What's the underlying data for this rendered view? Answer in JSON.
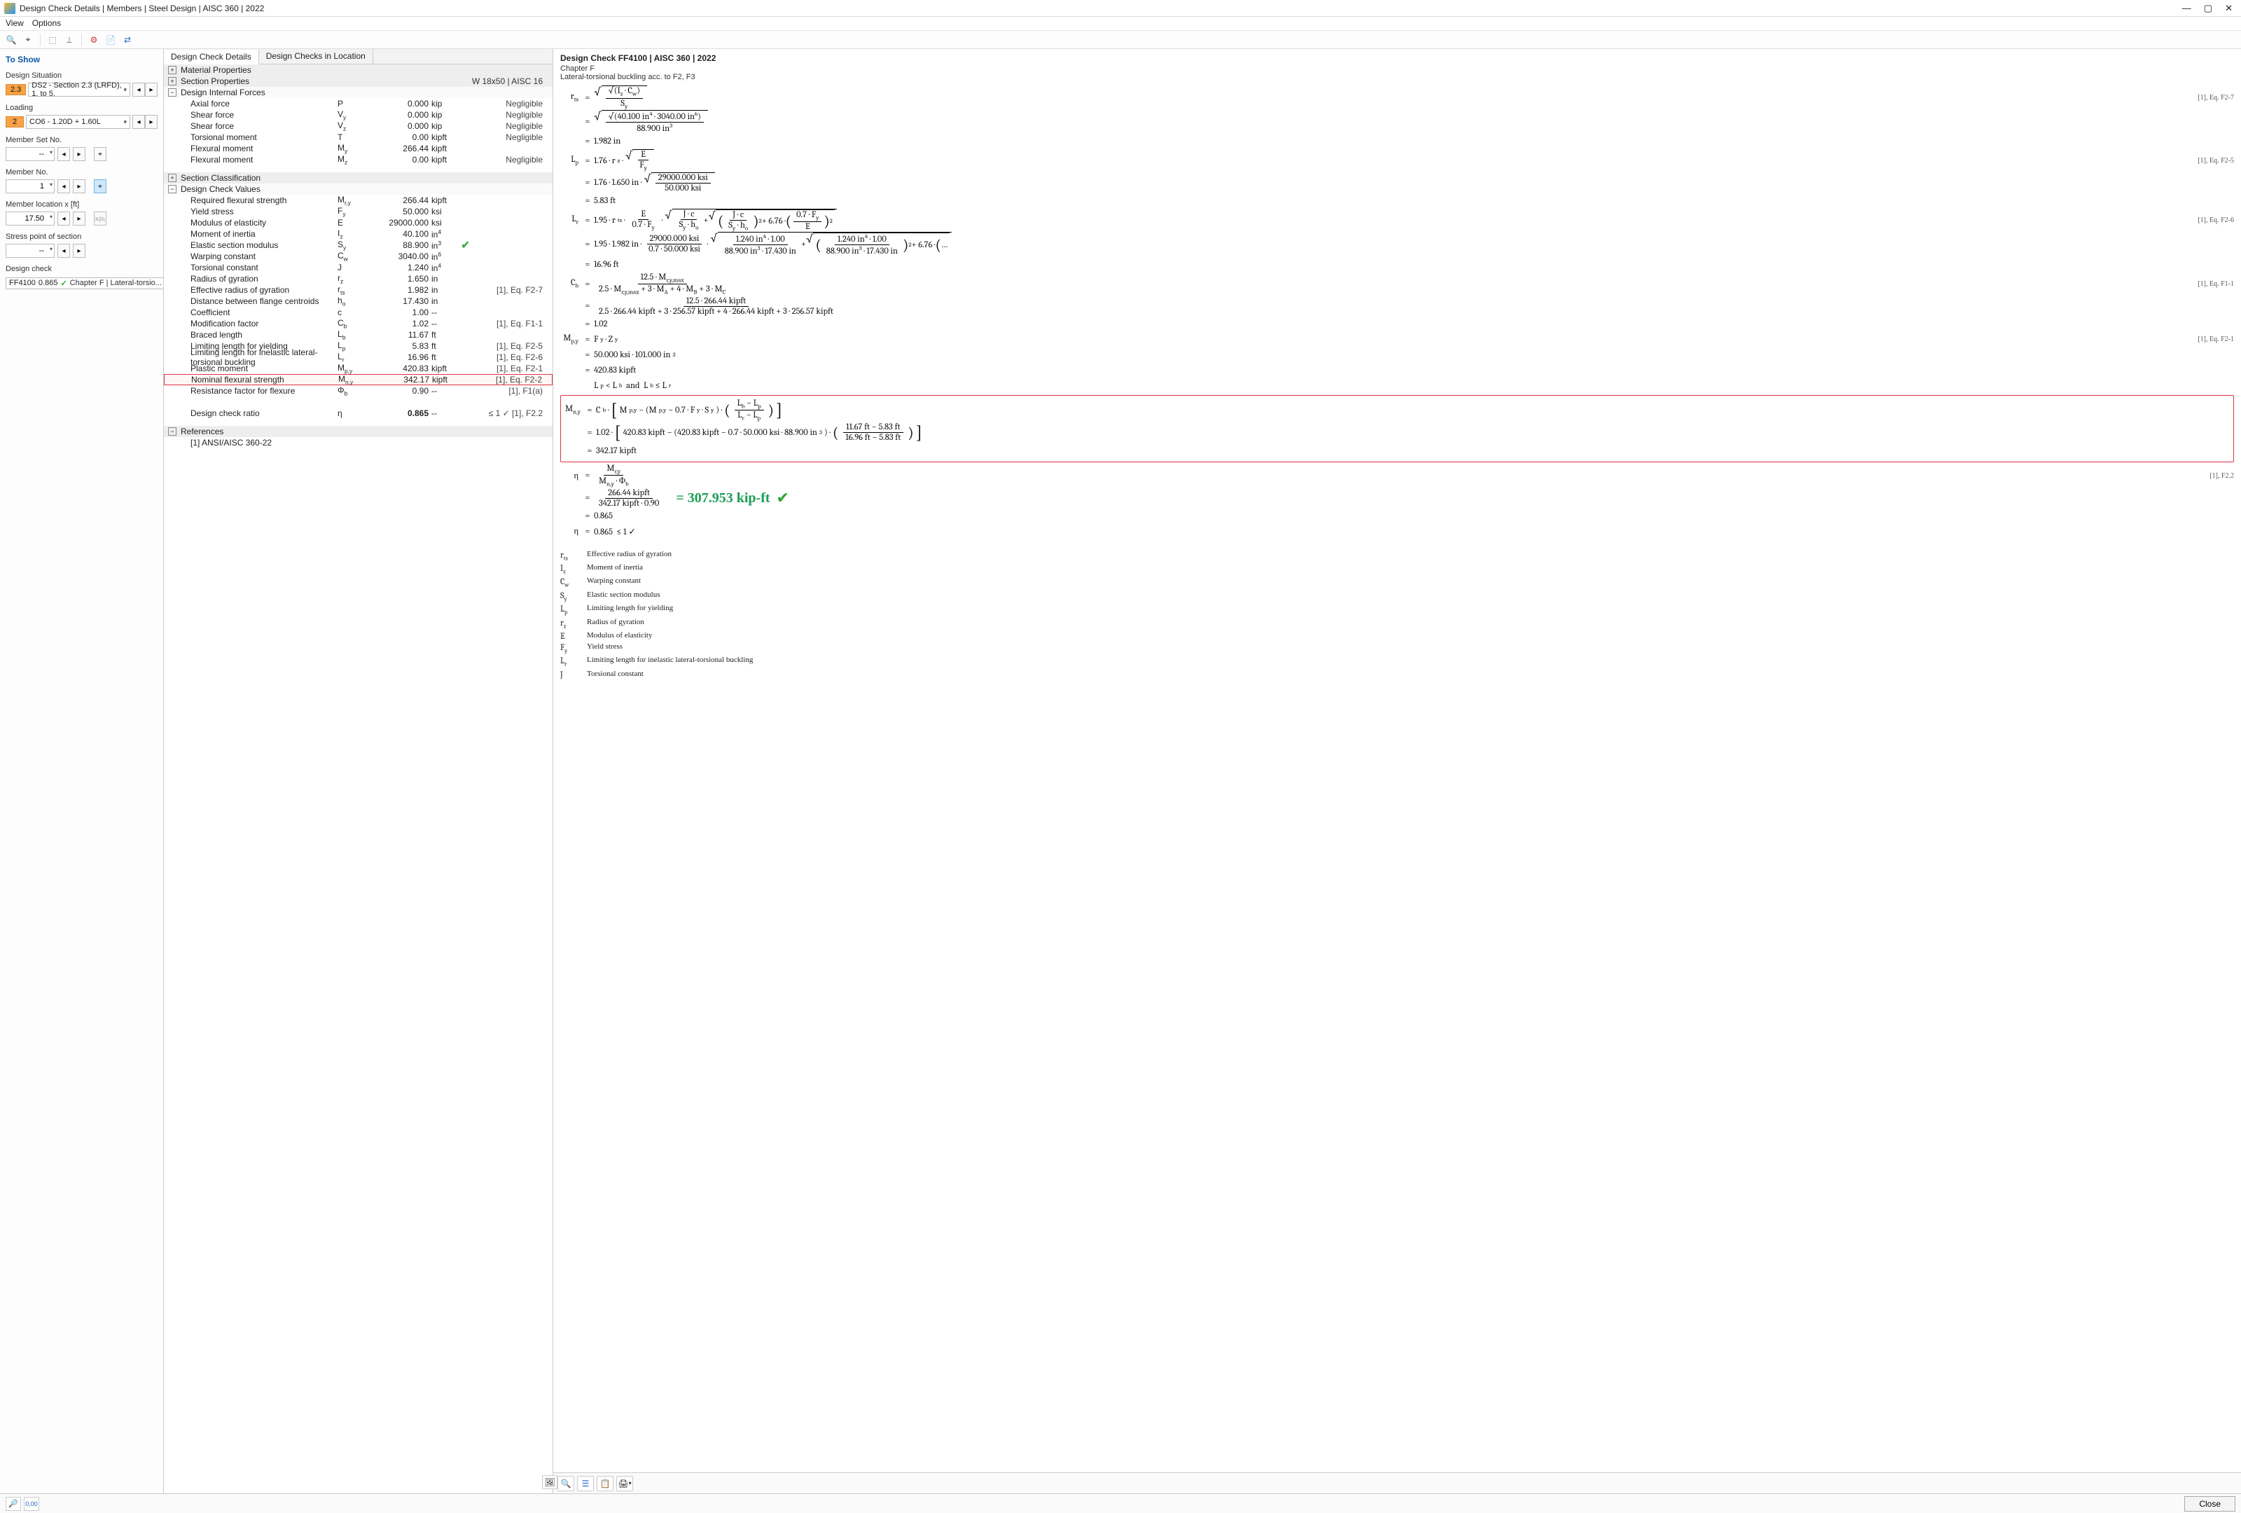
{
  "window": {
    "title": "Design Check Details | Members | Steel Design | AISC 360 | 2022",
    "menu": {
      "view": "View",
      "options": "Options"
    }
  },
  "sidebar": {
    "heading": "To Show",
    "design_situation_label": "Design Situation",
    "design_situation_badge": "2.3",
    "design_situation_value": "DS2 - Section 2.3 (LRFD), 1. to 5.",
    "loading_label": "Loading",
    "loading_badge": "2",
    "loading_value": "CO6 - 1.20D + 1.60L",
    "member_set_label": "Member Set No.",
    "member_set_value": "--",
    "member_no_label": "Member No.",
    "member_no_value": "1",
    "member_loc_label": "Member location x [ft]",
    "member_loc_value": "17.50",
    "stress_point_label": "Stress point of section",
    "stress_point_value": "--",
    "design_check_label": "Design check",
    "dc_id": "FF4100",
    "dc_ratio": "0.865",
    "dc_desc": "Chapter F | Lateral-torsio..."
  },
  "center": {
    "tab1": "Design Check Details",
    "tab2": "Design Checks in Location",
    "sections": {
      "mat": "Material Properties",
      "sect": "Section Properties",
      "sect_right": "W 18x50 | AISC 16",
      "forces": "Design Internal Forces",
      "class": "Section Classification",
      "values": "Design Check Values",
      "refs": "References",
      "ref1": "[1]  ANSI/AISC 360-22"
    },
    "forces": [
      {
        "lbl": "Axial force",
        "sym": "P",
        "val": "0.000",
        "unit": "kip",
        "ref": "Negligible"
      },
      {
        "lbl": "Shear force",
        "sym": "V<sub>y</sub>",
        "val": "0.000",
        "unit": "kip",
        "ref": "Negligible"
      },
      {
        "lbl": "Shear force",
        "sym": "V<sub>z</sub>",
        "val": "0.000",
        "unit": "kip",
        "ref": "Negligible"
      },
      {
        "lbl": "Torsional moment",
        "sym": "T",
        "val": "0.00",
        "unit": "kipft",
        "ref": "Negligible"
      },
      {
        "lbl": "Flexural moment",
        "sym": "M<sub>y</sub>",
        "val": "266.44",
        "unit": "kipft",
        "ref": ""
      },
      {
        "lbl": "Flexural moment",
        "sym": "M<sub>z</sub>",
        "val": "0.00",
        "unit": "kipft",
        "ref": "Negligible"
      }
    ],
    "values": [
      {
        "lbl": "Required flexural strength",
        "sym": "M<sub>r,y</sub>",
        "val": "266.44",
        "unit": "kipft",
        "ref": ""
      },
      {
        "lbl": "Yield stress",
        "sym": "F<sub>y</sub>",
        "val": "50.000",
        "unit": "ksi",
        "ref": ""
      },
      {
        "lbl": "Modulus of elasticity",
        "sym": "E",
        "val": "29000.000",
        "unit": "ksi",
        "ref": ""
      },
      {
        "lbl": "Moment of inertia",
        "sym": "I<sub>z</sub>",
        "val": "40.100",
        "unit": "in<sup>4</sup>",
        "ref": ""
      },
      {
        "lbl": "Elastic section modulus",
        "sym": "S<sub>y</sub>",
        "val": "88.900",
        "unit": "in<sup>3</sup>",
        "ref": "",
        "tick": true
      },
      {
        "lbl": "Warping constant",
        "sym": "C<sub>w</sub>",
        "val": "3040.00",
        "unit": "in<sup>6</sup>",
        "ref": ""
      },
      {
        "lbl": "Torsional constant",
        "sym": "J",
        "val": "1.240",
        "unit": "in<sup>4</sup>",
        "ref": ""
      },
      {
        "lbl": "Radius of gyration",
        "sym": "r<sub>z</sub>",
        "val": "1.650",
        "unit": "in",
        "ref": ""
      },
      {
        "lbl": "Effective radius of gyration",
        "sym": "r<sub>ts</sub>",
        "val": "1.982",
        "unit": "in",
        "ref": "[1], Eq. F2-7"
      },
      {
        "lbl": "Distance between flange centroids",
        "sym": "h<sub>o</sub>",
        "val": "17.430",
        "unit": "in",
        "ref": ""
      },
      {
        "lbl": "Coefficient",
        "sym": "c",
        "val": "1.00",
        "unit": "--",
        "ref": ""
      },
      {
        "lbl": "Modification factor",
        "sym": "C<sub>b</sub>",
        "val": "1.02",
        "unit": "--",
        "ref": "[1], Eq. F1-1"
      },
      {
        "lbl": "Braced length",
        "sym": "L<sub>b</sub>",
        "val": "11.67",
        "unit": "ft",
        "ref": ""
      },
      {
        "lbl": "Limiting length for yielding",
        "sym": "L<sub>p</sub>",
        "val": "5.83",
        "unit": "ft",
        "ref": "[1], Eq. F2-5"
      },
      {
        "lbl": "Limiting length for inelastic lateral-torsional buckling",
        "sym": "L<sub>r</sub>",
        "val": "16.96",
        "unit": "ft",
        "ref": "[1], Eq. F2-6"
      },
      {
        "lbl": "Plastic moment",
        "sym": "M<sub>p,y</sub>",
        "val": "420.83",
        "unit": "kipft",
        "ref": "[1], Eq. F2-1"
      },
      {
        "lbl": "Nominal flexural strength",
        "sym": "M<sub>n,y</sub>",
        "val": "342.17",
        "unit": "kipft",
        "ref": "[1], Eq. F2-2",
        "hl": true
      },
      {
        "lbl": "Resistance factor for flexure",
        "sym": "Φ<sub>b</sub>",
        "val": "0.90",
        "unit": "--",
        "ref": "[1], F1(a)"
      },
      {
        "lbl": "",
        "sym": "",
        "val": "",
        "unit": "",
        "ref": ""
      },
      {
        "lbl": "Design check ratio",
        "sym": "η",
        "val": "0.865",
        "unit": "--",
        "ref": "≤ 1   ✓   [1], F2.2",
        "bold": true
      }
    ]
  },
  "right": {
    "title": "Design Check FF4100 | AISC 360 | 2022",
    "chapter": "Chapter F",
    "subtitle": "Lateral-torsional buckling acc. to F2, F3",
    "refs": {
      "f27": "[1], Eq. F2-7",
      "f25": "[1], Eq. F2-5",
      "f26": "[1], Eq. F2-6",
      "f11": "[1], Eq. F1-1",
      "f21": "[1], Eq. F2-1",
      "f22eq": "[1], Eq. F2-2",
      "f22": "[1], F2.2"
    },
    "annot": "= 307.953 kip-ft",
    "final_ratio": "0.865",
    "final_cond": "≤ 1",
    "legend": [
      {
        "sym": "r<sub>ts</sub>",
        "desc": "Effective radius of gyration"
      },
      {
        "sym": "I<sub>z</sub>",
        "desc": "Moment of inertia"
      },
      {
        "sym": "C<sub>w</sub>",
        "desc": "Warping constant"
      },
      {
        "sym": "S<sub>y</sub>",
        "desc": "Elastic section modulus"
      },
      {
        "sym": "L<sub>p</sub>",
        "desc": "Limiting length for yielding"
      },
      {
        "sym": "r<sub>z</sub>",
        "desc": "Radius of gyration"
      },
      {
        "sym": "E",
        "desc": "Modulus of elasticity"
      },
      {
        "sym": "F<sub>y</sub>",
        "desc": "Yield stress"
      },
      {
        "sym": "L<sub>r</sub>",
        "desc": "Limiting length for inelastic lateral-torsional buckling"
      },
      {
        "sym": "J",
        "desc": "Torsional constant"
      }
    ]
  },
  "footer": {
    "close": "Close"
  }
}
